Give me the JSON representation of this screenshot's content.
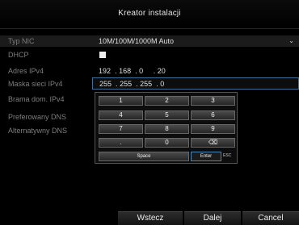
{
  "dialog": {
    "title": "Kreator instalacji"
  },
  "form": {
    "nic_type": {
      "label": "Typ NIC",
      "value": "10M/100M/1000M Auto",
      "icon": "chevron-down-icon"
    },
    "dhcp": {
      "label": "DHCP",
      "checked": false
    },
    "ipv4": {
      "label": "Adres IPv4",
      "segments": [
        "192",
        "168",
        "0",
        "20"
      ]
    },
    "mask": {
      "label": "Maska sieci IPv4",
      "segments": [
        "255",
        "255",
        "255",
        "0"
      ]
    },
    "gateway": {
      "label": "Brama dom. IPv4"
    },
    "dns_preferred": {
      "label": "Preferowany DNS"
    },
    "dns_alternate": {
      "label": "Alternatywny DNS"
    }
  },
  "keypad": {
    "keys": [
      "1",
      "2",
      "3",
      "4",
      "5",
      "6",
      "7",
      "8",
      "9",
      ".",
      "0",
      "⌫"
    ],
    "space": "Space",
    "enter": "Enter",
    "esc": "ESC"
  },
  "buttons": {
    "back": "Wstecz",
    "next": "Dalej",
    "cancel": "Cancel"
  }
}
